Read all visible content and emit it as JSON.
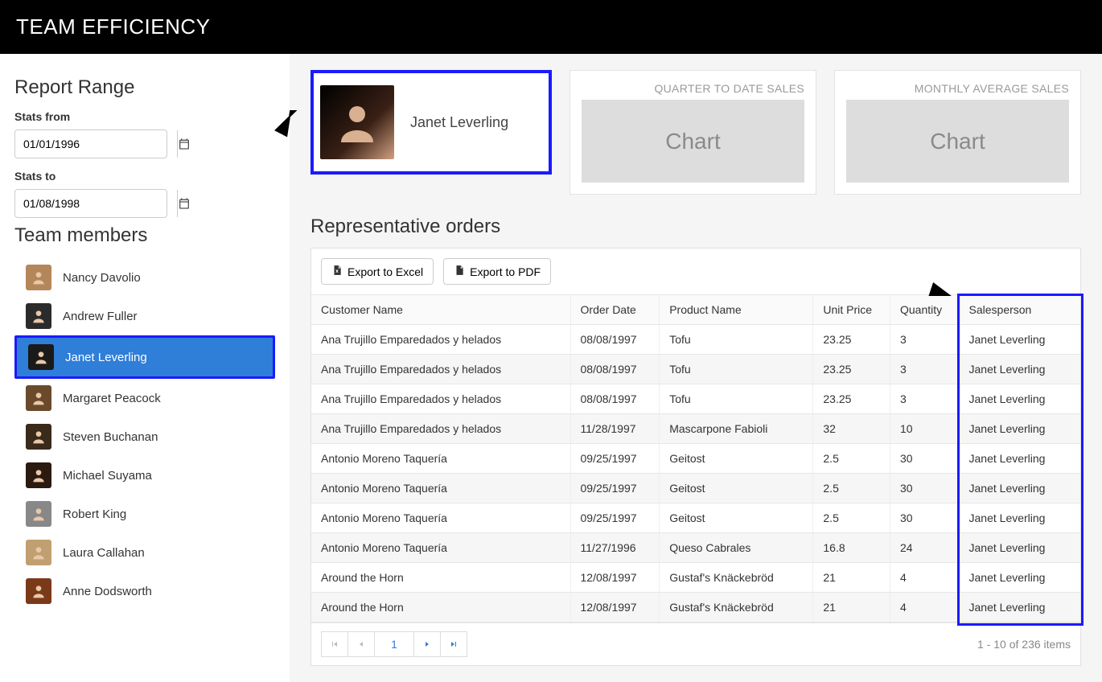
{
  "header": {
    "title": "TEAM EFFICIENCY"
  },
  "sidebar": {
    "range_title": "Report Range",
    "from_label": "Stats from",
    "from_value": "01/01/1996",
    "to_label": "Stats to",
    "to_value": "01/08/1998",
    "members_title": "Team members",
    "selected_index": 2,
    "members": [
      {
        "name": "Nancy Davolio",
        "avatar_color": "#b4875a"
      },
      {
        "name": "Andrew Fuller",
        "avatar_color": "#2b2b2b"
      },
      {
        "name": "Janet Leverling",
        "avatar_color": "#1a1a1a"
      },
      {
        "name": "Margaret Peacock",
        "avatar_color": "#6b4a2b"
      },
      {
        "name": "Steven Buchanan",
        "avatar_color": "#3a2a1a"
      },
      {
        "name": "Michael Suyama",
        "avatar_color": "#2a1a10"
      },
      {
        "name": "Robert King",
        "avatar_color": "#888"
      },
      {
        "name": "Laura Callahan",
        "avatar_color": "#c0a070"
      },
      {
        "name": "Anne Dodsworth",
        "avatar_color": "#7a3a1a"
      }
    ]
  },
  "main": {
    "identity": {
      "name": "Janet Leverling"
    },
    "stat_cards": [
      {
        "title": "QUARTER TO DATE SALES",
        "placeholder": "Chart"
      },
      {
        "title": "MONTHLY AVERAGE SALES",
        "placeholder": "Chart"
      }
    ],
    "orders_title": "Representative orders",
    "toolbar": {
      "export_excel": "Export to Excel",
      "export_pdf": "Export to PDF"
    },
    "columns": [
      "Customer Name",
      "Order Date",
      "Product Name",
      "Unit Price",
      "Quantity",
      "Salesperson"
    ],
    "rows": [
      {
        "customer": "Ana Trujillo Emparedados y helados",
        "date": "08/08/1997",
        "product": "Tofu",
        "price": "23.25",
        "qty": "3",
        "sales": "Janet Leverling"
      },
      {
        "customer": "Ana Trujillo Emparedados y helados",
        "date": "08/08/1997",
        "product": "Tofu",
        "price": "23.25",
        "qty": "3",
        "sales": "Janet Leverling"
      },
      {
        "customer": "Ana Trujillo Emparedados y helados",
        "date": "08/08/1997",
        "product": "Tofu",
        "price": "23.25",
        "qty": "3",
        "sales": "Janet Leverling"
      },
      {
        "customer": "Ana Trujillo Emparedados y helados",
        "date": "11/28/1997",
        "product": "Mascarpone Fabioli",
        "price": "32",
        "qty": "10",
        "sales": "Janet Leverling"
      },
      {
        "customer": "Antonio Moreno Taquería",
        "date": "09/25/1997",
        "product": "Geitost",
        "price": "2.5",
        "qty": "30",
        "sales": "Janet Leverling"
      },
      {
        "customer": "Antonio Moreno Taquería",
        "date": "09/25/1997",
        "product": "Geitost",
        "price": "2.5",
        "qty": "30",
        "sales": "Janet Leverling"
      },
      {
        "customer": "Antonio Moreno Taquería",
        "date": "09/25/1997",
        "product": "Geitost",
        "price": "2.5",
        "qty": "30",
        "sales": "Janet Leverling"
      },
      {
        "customer": "Antonio Moreno Taquería",
        "date": "11/27/1996",
        "product": "Queso Cabrales",
        "price": "16.8",
        "qty": "24",
        "sales": "Janet Leverling"
      },
      {
        "customer": "Around the Horn",
        "date": "12/08/1997",
        "product": "Gustaf's Knäckebröd",
        "price": "21",
        "qty": "4",
        "sales": "Janet Leverling"
      },
      {
        "customer": "Around the Horn",
        "date": "12/08/1997",
        "product": "Gustaf's Knäckebröd",
        "price": "21",
        "qty": "4",
        "sales": "Janet Leverling"
      }
    ],
    "pager": {
      "page": "1",
      "info": "1 - 10 of 236 items"
    }
  }
}
